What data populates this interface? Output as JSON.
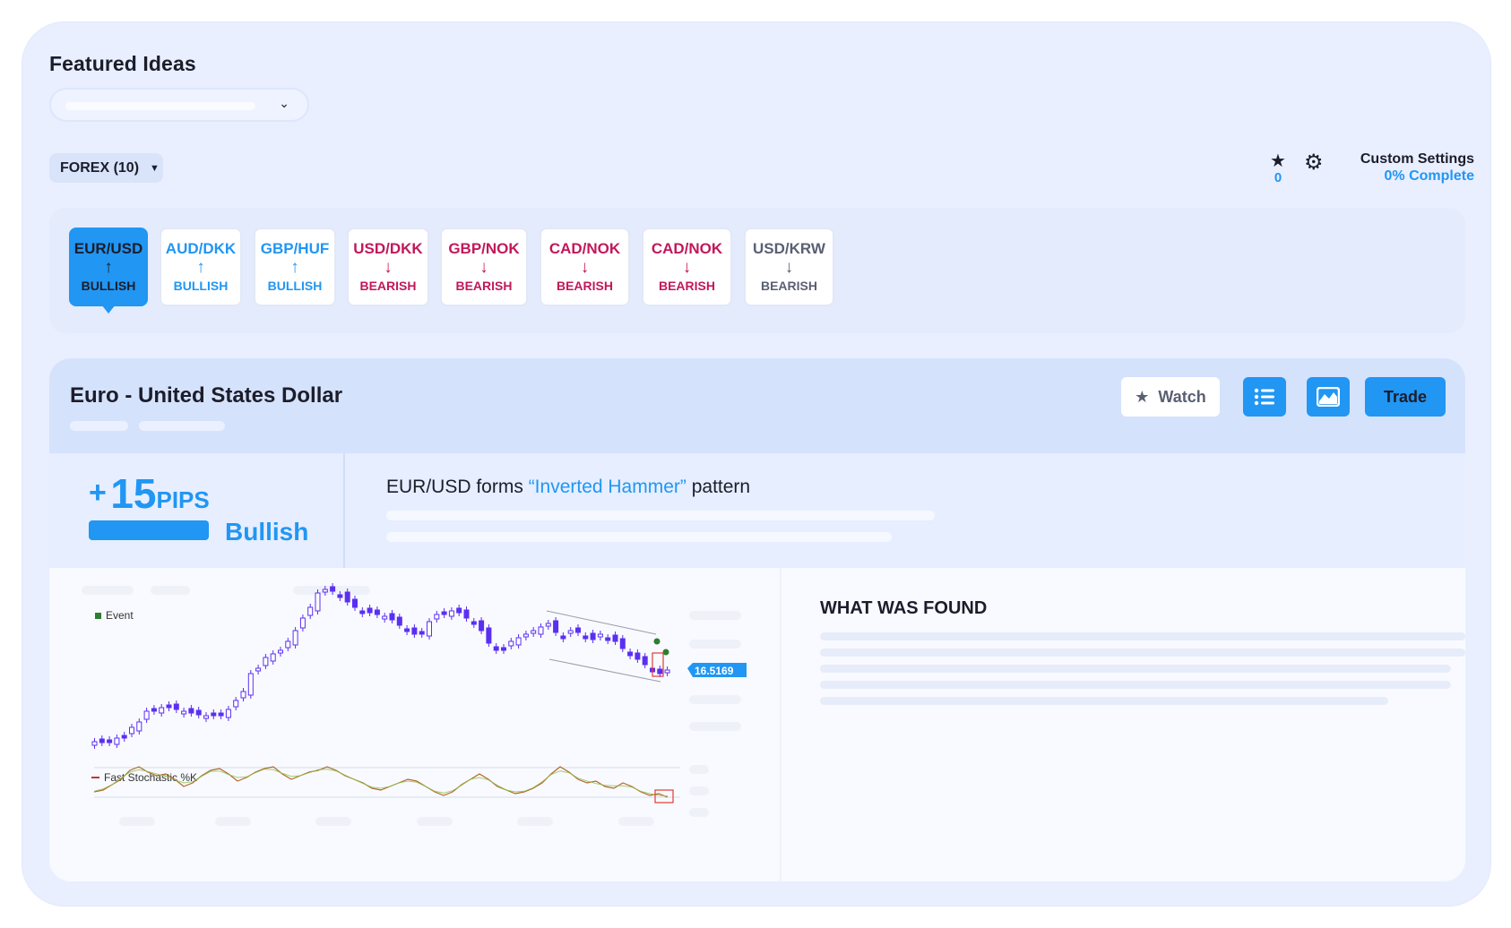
{
  "header": {
    "title": "Featured Ideas",
    "market_filter": "FOREX (10)",
    "watch_count": "0",
    "custom_settings_label": "Custom Settings",
    "custom_settings_progress": "0% Complete"
  },
  "pairs": [
    {
      "name": "EUR/USD",
      "direction": "BULLISH",
      "arrow": "↑",
      "active": true
    },
    {
      "name": "AUD/DKK",
      "direction": "BULLISH",
      "arrow": "↑"
    },
    {
      "name": "GBP/HUF",
      "direction": "BULLISH",
      "arrow": "↑"
    },
    {
      "name": "USD/DKK",
      "direction": "BEARISH",
      "arrow": "↓"
    },
    {
      "name": "GBP/NOK",
      "direction": "BEARISH",
      "arrow": "↓"
    },
    {
      "name": "CAD/NOK",
      "direction": "BEARISH",
      "arrow": "↓"
    },
    {
      "name": "CAD/NOK",
      "direction": "BEARISH",
      "arrow": "↓"
    },
    {
      "name": "USD/KRW",
      "direction": "BEARISH",
      "arrow": "↓"
    }
  ],
  "detail": {
    "instrument_name": "Euro - United States Dollar",
    "watch_label": "Watch",
    "trade_label": "Trade",
    "pips_sign": "+",
    "pips_value": "15",
    "pips_unit": "PIPS",
    "sentiment": "Bullish",
    "headline_prefix": "EUR/USD forms ",
    "headline_pattern": "“Inverted Hammer”",
    "headline_suffix": " pattern"
  },
  "chart": {
    "legend_event": "Event",
    "legend_stochastic": "Fast Stochastic %K",
    "price_label": "16.5169"
  },
  "found": {
    "title": "WHAT WAS FOUND"
  },
  "colors": {
    "accent": "#2196f3",
    "bullish_blue": "#2196f3",
    "bearish_red": "#c2185b",
    "neutral_gray": "#5a5f73",
    "candle": "#5b2ff2",
    "card_bg": "#e9efff"
  },
  "icons": {
    "watch_count": "star-icon",
    "settings": "gear-icon",
    "dropdown": "chevron-down-icon",
    "list_view": "list-icon",
    "chart_view": "chart-icon",
    "watch_button": "star-icon"
  }
}
